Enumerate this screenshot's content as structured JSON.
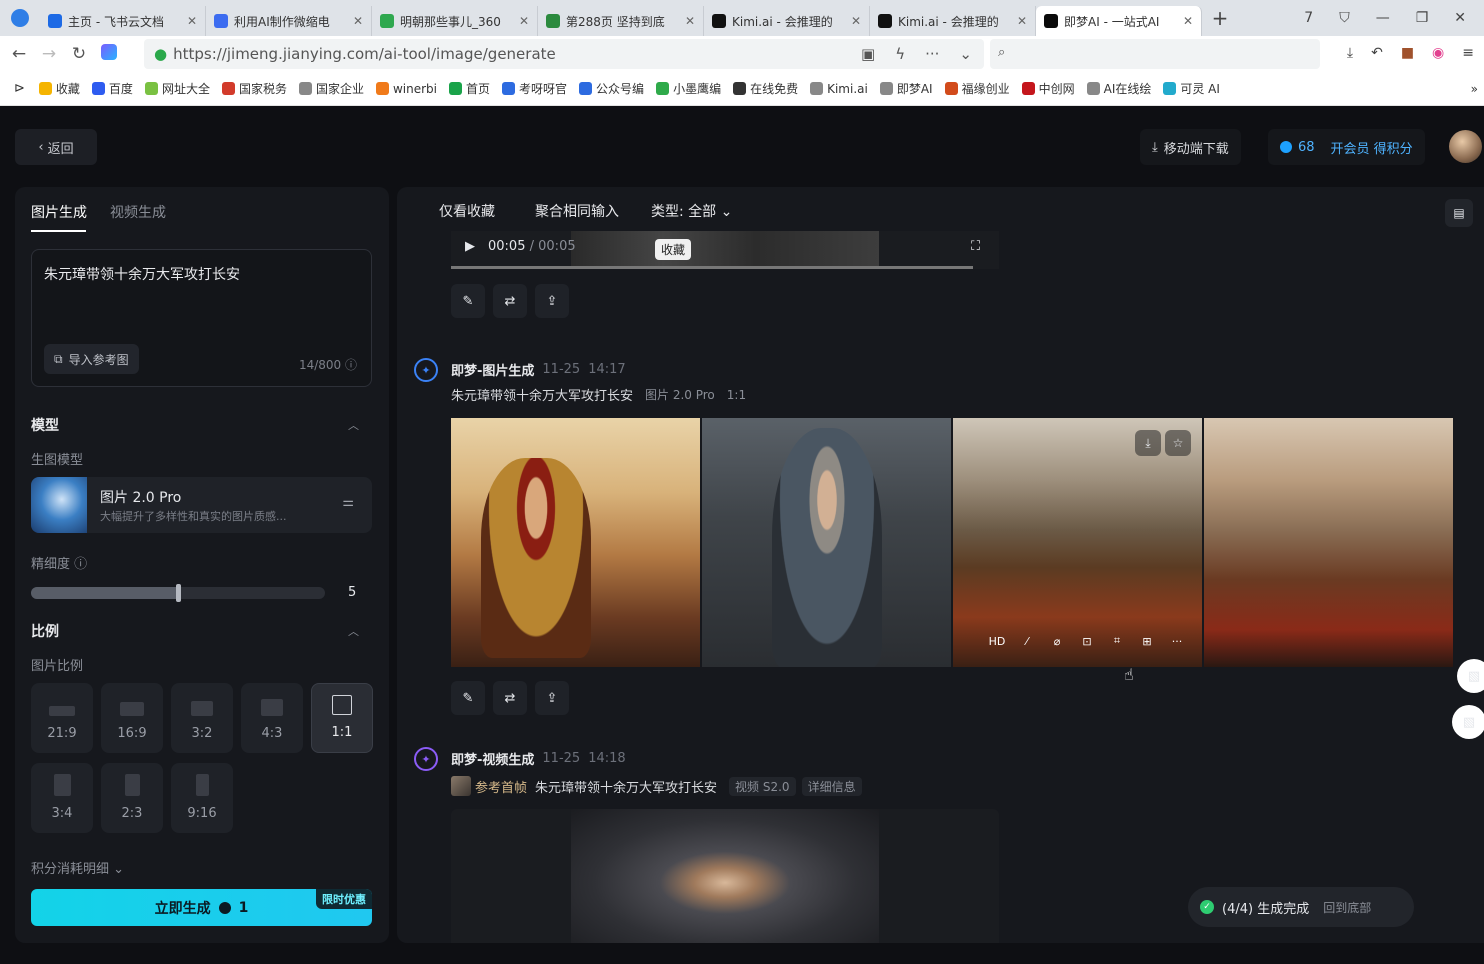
{
  "browser": {
    "tabs": [
      {
        "label": "主页 - 飞书云文档",
        "color": "#1d6ae5"
      },
      {
        "label": "利用AI制作微缩电",
        "color": "#3c6cf0"
      },
      {
        "label": "明朝那些事儿_360",
        "color": "#2fa84f"
      },
      {
        "label": "第288页 坚持到底",
        "color": "#2b8a3e"
      },
      {
        "label": "Kimi.ai - 会推理的",
        "color": "#111111"
      },
      {
        "label": "Kimi.ai - 会推理的",
        "color": "#111111"
      },
      {
        "label": "即梦AI - 一站式AI",
        "color": "#0a0a0a"
      }
    ],
    "url": "https://jimeng.jianying.com/ai-tool/image/generate",
    "bookmarks": [
      {
        "label": "收藏",
        "color": "#f5b400"
      },
      {
        "label": "百度",
        "color": "#2e5cf0"
      },
      {
        "label": "网址大全",
        "color": "#7ac142"
      },
      {
        "label": "国家税务",
        "color": "#d23b2b"
      },
      {
        "label": "国家企业",
        "color": "#888888"
      },
      {
        "label": "winerbi",
        "color": "#f07a1a"
      },
      {
        "label": "首页",
        "color": "#1aa34a"
      },
      {
        "label": "考呀呀官",
        "color": "#2d6be0"
      },
      {
        "label": "公众号编",
        "color": "#2d6be0"
      },
      {
        "label": "小墨鹰编",
        "color": "#2faa4a"
      },
      {
        "label": "在线免费",
        "color": "#333333"
      },
      {
        "label": "Kimi.ai",
        "color": "#888888"
      },
      {
        "label": "即梦AI",
        "color": "#888888"
      },
      {
        "label": "福缘创业",
        "color": "#d24b1b"
      },
      {
        "label": "中创网",
        "color": "#c4161c"
      },
      {
        "label": "AI在线绘",
        "color": "#888888"
      },
      {
        "label": "可灵 AI",
        "color": "#22aacc"
      }
    ]
  },
  "header": {
    "back_label": "返回",
    "mobile_download": "移动端下载",
    "points": "68",
    "vip_label": "开会员 得积分"
  },
  "left": {
    "tabs": [
      "图片生成",
      "视频生成"
    ],
    "prompt_text": "朱元璋带领十余万大军攻打长安",
    "import_ref": "导入参考图",
    "char_count": "14/800",
    "model_section": "模型",
    "model_sub": "生图模型",
    "model_name": "图片 2.0 Pro",
    "model_desc": "大幅提升了多样性和真实的图片质感...",
    "precision_label": "精细度",
    "precision_value": "5",
    "precision_fraction": 0.5,
    "ratio_section": "比例",
    "ratio_sub": "图片比例",
    "ratios": [
      "21:9",
      "16:9",
      "3:2",
      "4:3",
      "1:1",
      "3:4",
      "2:3",
      "9:16"
    ],
    "selected_ratio": "1:1",
    "cost_detail": "积分消耗明细",
    "generate_label": "立即生成",
    "generate_cost": "1",
    "promo_badge": "限时优惠"
  },
  "main": {
    "filters": [
      "仅看收藏",
      "聚合相同输入",
      "类型: 全部"
    ],
    "video1": {
      "time_current": "00:05",
      "time_sep": "/",
      "time_total": "00:05",
      "fav_tooltip": "收藏"
    },
    "image_gen": {
      "title": "即梦-图片生成",
      "date": "11-25",
      "time": "14:17",
      "prompt": "朱元璋带领十余万大军攻打长安",
      "model_tag": "图片 2.0 Pro",
      "ratio_tag": "1:1",
      "hd_label": "HD",
      "more_label": "···"
    },
    "video_gen": {
      "title": "即梦-视频生成",
      "date": "11-25",
      "time": "14:18",
      "ref_label": "参考首帧",
      "prompt": "朱元璋带领十余万大军攻打长安",
      "model_tag": "视频 S2.0",
      "detail_label": "详细信息"
    },
    "toast": {
      "status": "(4/4) 生成完成",
      "back_to_bottom": "回到底部"
    }
  }
}
